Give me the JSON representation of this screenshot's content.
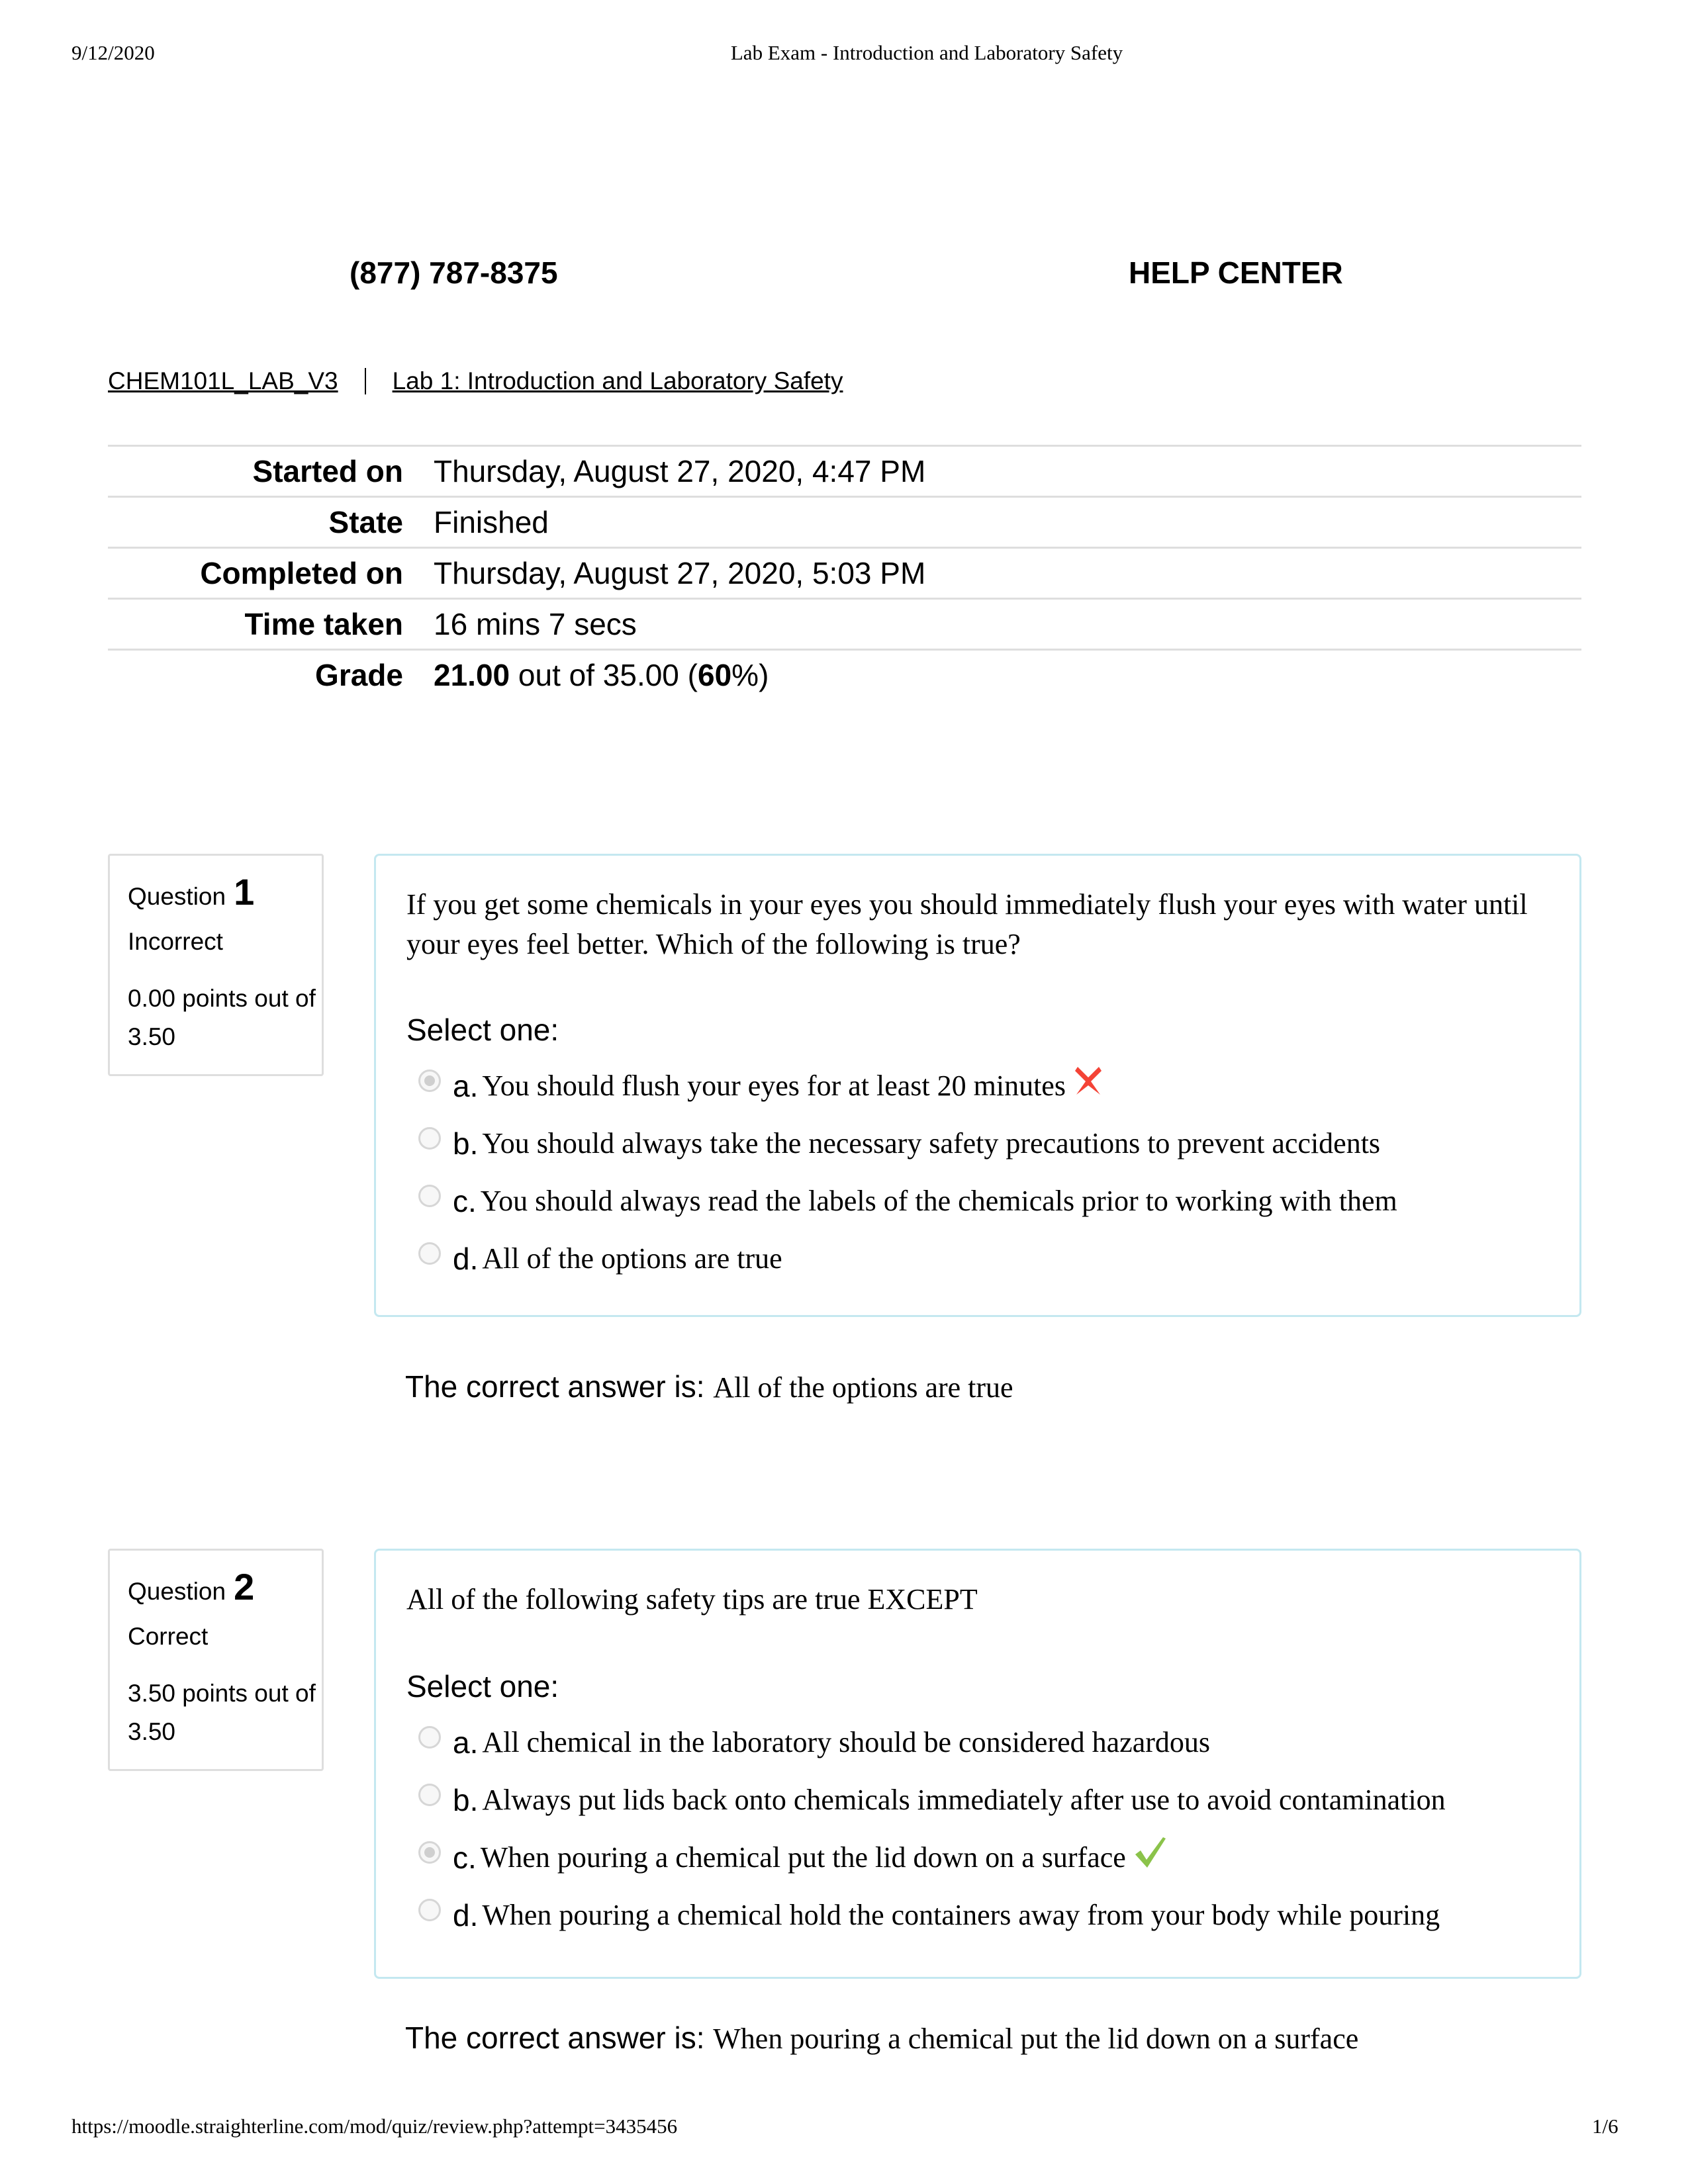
{
  "print_header": {
    "date": "9/12/2020",
    "title": "Lab Exam - Introduction and Laboratory Safety"
  },
  "topbar": {
    "phone": "(877) 787-8375",
    "help_center": "HELP CENTER"
  },
  "breadcrumb": {
    "items": [
      {
        "label": "CHEM101L_LAB_V3"
      },
      {
        "label": "Lab 1: Introduction and Laboratory Safety"
      }
    ]
  },
  "summary": {
    "rows": [
      {
        "label": "Started on",
        "value": "Thursday, August 27, 2020, 4:47 PM"
      },
      {
        "label": "State",
        "value": "Finished"
      },
      {
        "label": "Completed on",
        "value": "Thursday, August 27, 2020, 5:03 PM"
      },
      {
        "label": "Time taken",
        "value": "16 mins 7 secs"
      }
    ],
    "grade": {
      "label": "Grade",
      "score": "21.00",
      "out_of_text": " out of 35.00 (",
      "percent": "60",
      "suffix": "%)"
    }
  },
  "questions": [
    {
      "label": "Question",
      "number": "1",
      "state": "Incorrect",
      "grade_text": "0.00 points out of 3.50",
      "text": "If you get some chemicals in your eyes you should immediately flush your eyes with water until your eyes feel better. Which of the following is true?",
      "prompt": "Select one:",
      "answers": [
        {
          "letter": "a.",
          "text": "You should flush your eyes for at least 20 minutes",
          "checked": true,
          "feedback": "incorrect-icon"
        },
        {
          "letter": "b.",
          "text": "You should always take the necessary safety precautions to prevent accidents",
          "checked": false,
          "feedback": ""
        },
        {
          "letter": "c.",
          "text": "You should always read the labels of the chemicals prior to working with them",
          "checked": false,
          "feedback": ""
        },
        {
          "letter": "d.",
          "text": "All of the options are true",
          "checked": false,
          "feedback": ""
        }
      ],
      "right_answer_label": "The correct answer is: ",
      "right_answer": "All of the options are true"
    },
    {
      "label": "Question",
      "number": "2",
      "state": "Correct",
      "grade_text": "3.50 points out of 3.50",
      "text": "All of the following safety tips are true EXCEPT",
      "prompt": "Select one:",
      "answers": [
        {
          "letter": "a.",
          "text": "All chemical in the laboratory should be considered hazardous",
          "checked": false,
          "feedback": ""
        },
        {
          "letter": "b.",
          "text": "Always put lids back onto chemicals immediately after use to avoid contamination",
          "checked": false,
          "feedback": ""
        },
        {
          "letter": "c.",
          "text": "When pouring a chemical put the lid down on a surface",
          "checked": true,
          "feedback": "correct-icon"
        },
        {
          "letter": "d.",
          "text": "When pouring a chemical hold the containers away from your body while pouring",
          "checked": false,
          "feedback": ""
        }
      ],
      "right_answer_label": "The correct answer is: ",
      "right_answer": "When pouring a chemical put the lid down on a surface"
    }
  ],
  "colors": {
    "incorrect": "#f44336",
    "correct": "#8bc34a",
    "question_border": "#c4e8f0",
    "info_border": "#dedede"
  },
  "print_footer": {
    "url": "https://moodle.straighterline.com/mod/quiz/review.php?attempt=3435456",
    "page": "1/6"
  }
}
